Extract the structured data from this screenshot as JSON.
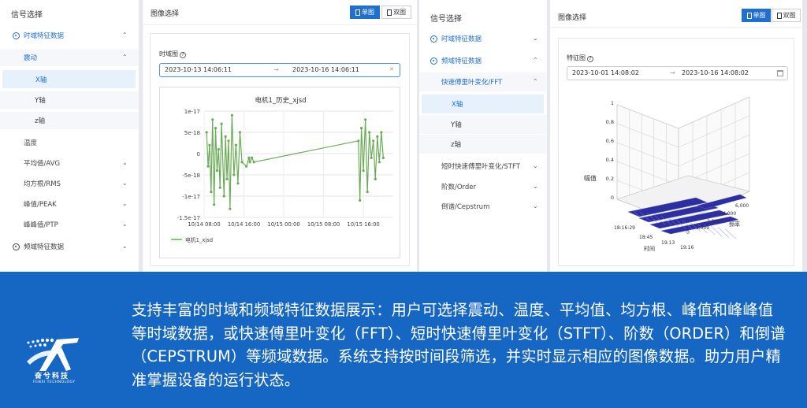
{
  "left_panel": {
    "sidebar": {
      "title": "信号选择",
      "items": [
        {
          "label": "时域特征数据",
          "icon": "gear-icon",
          "chevron": "^"
        },
        {
          "label": "震动",
          "chevron": "^"
        },
        {
          "label": "X轴"
        },
        {
          "label": "Y轴"
        },
        {
          "label": "z轴"
        },
        {
          "label": "温度"
        },
        {
          "label": "平均值/AVG",
          "chevron": "v"
        },
        {
          "label": "均方根/RMS",
          "chevron": "v"
        },
        {
          "label": "峰值/PEAK",
          "chevron": "v"
        },
        {
          "label": "峰峰值/PTP",
          "chevron": "v"
        },
        {
          "label": "频域特征数据",
          "icon": "gear-icon",
          "chevron": "v"
        }
      ]
    },
    "main": {
      "header": "图像选择",
      "single_button": "单图",
      "double_button": "双图",
      "field_label": "时域图",
      "help": "?",
      "range_start": "2023-10-13 14:06:11",
      "range_arrow": "→",
      "range_end": "2023-10-16 14:06:11",
      "clear": "✕"
    },
    "chart_data": {
      "type": "line",
      "title": "电机1_历史_xjsd",
      "xlabel": "",
      "ylabel": "",
      "x_tick_labels": [
        "10/14 08:00",
        "10/14 16:00",
        "10/15 00:00",
        "10/15 08:00",
        "10/15 16:00"
      ],
      "y_tick_labels": [
        "1e-17",
        "5e-18",
        "0",
        "-5e-18",
        "-1e-17",
        "-1.5e-17"
      ],
      "ylim": [
        -1.5e-17,
        1e-17
      ],
      "legend": "bottom-left",
      "grid": true,
      "color": "#6aab55",
      "series": [
        {
          "name": "电机1_xjsd",
          "x_hours_from_1014_0800": [
            0.5,
            0.8,
            1.1,
            1.4,
            1.7,
            2.0,
            2.3,
            2.6,
            2.9,
            3.2,
            3.5,
            4.0,
            4.3,
            4.6,
            4.9,
            5.2,
            5.6,
            6.0,
            6.4,
            6.8,
            7.2,
            7.6,
            8.5,
            9.0,
            9.2,
            9.6,
            10.0,
            31.0,
            31.3,
            31.6,
            32.0,
            32.4,
            32.8,
            33.2,
            33.6,
            34.0,
            34.4,
            34.8,
            35.2,
            35.6,
            36.0
          ],
          "values": [
            5e-18,
            -3e-18,
            2e-18,
            -9e-18,
            8e-18,
            -1.2e-17,
            6e-18,
            -4e-18,
            1e-18,
            -8e-18,
            7e-18,
            -1e-17,
            4e-18,
            -6e-18,
            3e-18,
            -1.3e-17,
            9e-18,
            -5e-18,
            2e-18,
            -7e-18,
            5e-18,
            -2e-18,
            -3e-18,
            -1e-18,
            -2e-18,
            -1e-18,
            -2e-18,
            3e-18,
            -1.1e-17,
            6e-18,
            -4e-18,
            8e-18,
            -9e-18,
            5e-18,
            -1e-18,
            3e-18,
            -6e-18,
            4e-18,
            -2e-18,
            5e-18,
            -1e-18
          ]
        }
      ]
    }
  },
  "right_panel": {
    "sidebar": {
      "title": "信号选择",
      "items": [
        {
          "label": "时域特征数据",
          "icon": "gear-icon",
          "chevron": "v"
        },
        {
          "label": "频域特征数据",
          "icon": "gear-icon",
          "chevron": "^"
        },
        {
          "label": "快速傅里叶变化/FFT",
          "chevron": "^"
        },
        {
          "label": "X轴"
        },
        {
          "label": "Y轴"
        },
        {
          "label": "z轴"
        },
        {
          "label": "短时快速傅里叶变化/STFT",
          "chevron": "v"
        },
        {
          "label": "阶数/Order",
          "chevron": "v"
        },
        {
          "label": "倒谱/Cepstrum",
          "chevron": "v"
        }
      ]
    },
    "main": {
      "header": "图像选择",
      "single_button": "单图",
      "double_button": "双图",
      "field_label": "特征图",
      "help": "?",
      "range_start": "2023-10-01 14:08:02",
      "range_arrow": "→",
      "range_end": "2023-10-16 14:08:02",
      "calendar_icon": "calendar-icon"
    },
    "chart_data": {
      "type": "surface3d",
      "zlabel": "幅值",
      "xlabel": "时间",
      "ylabel": "频率",
      "z_tick_labels": [
        "0",
        "0.2",
        "0.4",
        "0.6",
        "0.8",
        "1"
      ],
      "x_tick_labels": [
        "18:16:29",
        "18:45",
        "19:13",
        "19:16"
      ],
      "y_tick_labels": [
        "6,000",
        "4,000",
        "2,000",
        "1,000",
        "0"
      ],
      "zlim": [
        0,
        1
      ],
      "color": "#2e2f9e"
    }
  },
  "banner": {
    "text": "支持丰富的时域和频域特征数据展示：用户可选择震动、温度、平均值、均方根、峰值和峰峰值等时域数据，或快速傅里叶变化（FFT）、短时快速傅里叶变化（STFT）、阶数（ORDER）和倒谱（CEPSTRUM）等频域数据。系统支持按时间段筛选，并实时显示相应的图像数据。助力用户精准掌握设备的运行状态。",
    "logo_name": "奋兮科技",
    "logo_en": "FENXI TECHNOLOGY"
  }
}
